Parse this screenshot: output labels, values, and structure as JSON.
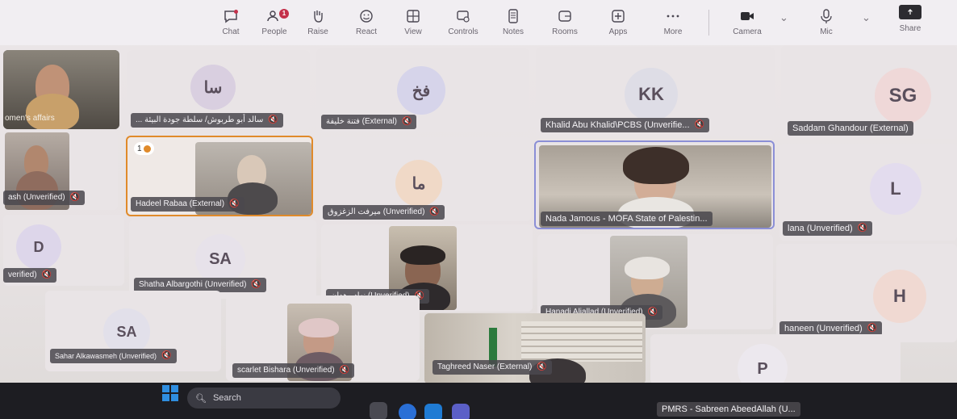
{
  "toolbar": {
    "buttons": [
      {
        "label": "Chat",
        "icon": "chat-icon"
      },
      {
        "label": "People",
        "icon": "people-icon",
        "badge": "1"
      },
      {
        "label": "Raise",
        "icon": "raise-hand-icon"
      },
      {
        "label": "React",
        "icon": "react-icon"
      },
      {
        "label": "View",
        "icon": "view-icon"
      },
      {
        "label": "Controls",
        "icon": "controls-icon"
      },
      {
        "label": "Notes",
        "icon": "notes-icon"
      },
      {
        "label": "Rooms",
        "icon": "rooms-icon"
      },
      {
        "label": "Apps",
        "icon": "apps-icon"
      },
      {
        "label": "More",
        "icon": "more-icon"
      },
      {
        "label": "Camera",
        "icon": "camera-icon"
      },
      {
        "label": "Mic",
        "icon": "mic-icon"
      },
      {
        "label": "Share",
        "icon": "share-icon"
      }
    ]
  },
  "participants": [
    {
      "name": "omen's affairs",
      "type": "video"
    },
    {
      "name": "... سالد أبو طربوش/ سلطة جودة البيئة",
      "initials": "سا",
      "type": "avatar"
    },
    {
      "name": "فتنة خليفة (External)",
      "initials": "فخ",
      "type": "avatar"
    },
    {
      "name": "Khalid Abu Khalid\\PCBS (Unverifie...",
      "initials": "KK",
      "type": "avatar"
    },
    {
      "name": "Saddam Ghandour (External)",
      "initials": "SG",
      "type": "avatar"
    },
    {
      "name": "ash (Unverified)",
      "type": "video"
    },
    {
      "name": "Hadeel Rabaa (External)",
      "type": "video",
      "reaction_count": "1"
    },
    {
      "name": "ميرفت الزغزوق (Unverified)",
      "initials": "ما",
      "type": "avatar"
    },
    {
      "name": "Nada Jamous - MOFA State of Palestin...",
      "type": "video"
    },
    {
      "name": "lana (Unverified)",
      "initials": "L",
      "type": "avatar"
    },
    {
      "name": "verified)",
      "initials": "D",
      "type": "avatar"
    },
    {
      "name": "Shatha Albargothi (Unverified)",
      "initials": "SA",
      "type": "avatar"
    },
    {
      "name": "نهاد وهدان (Unverified)",
      "type": "video"
    },
    {
      "name": "Hanadi Aljallad (Unverified)",
      "type": "video"
    },
    {
      "name": "haneen (Unverified)",
      "initials": "H",
      "type": "avatar"
    },
    {
      "name": "Sahar Alkawasmeh (Unverified)",
      "initials": "SA",
      "type": "avatar"
    },
    {
      "name": "scarlet Bishara (Unverified)",
      "type": "video"
    },
    {
      "name": "Taghreed Naser (External)",
      "type": "video"
    },
    {
      "name": "PMRS - Sabreen AbeedAllah (U...",
      "initials": "P",
      "type": "avatar"
    }
  ],
  "taskbar": {
    "search_placeholder": "Search"
  },
  "colors": {
    "toolbar_bg": "#f1eef2",
    "tile_bg": "#e9e4e6",
    "active_speaker_border": "#8b8fd6",
    "raised_hand_border": "#e08a2a",
    "badge": "#c4314b"
  }
}
